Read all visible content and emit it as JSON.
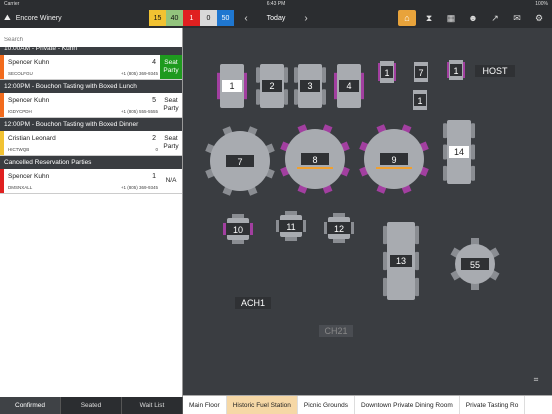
{
  "status": {
    "carrier": "Carrier",
    "time": "6:43 PM",
    "battery": "100%"
  },
  "app": {
    "name": "Encore Winery",
    "logo_icon": "vineyard-logo-icon"
  },
  "counts": [
    {
      "value": "15",
      "color": "#f1c232"
    },
    {
      "value": "40",
      "color": "#93c47d"
    },
    {
      "value": "1",
      "color": "#e02020"
    },
    {
      "value": "0",
      "color": "#d9d9d9"
    },
    {
      "value": "50",
      "color": "#1f77d0"
    }
  ],
  "date_nav": {
    "label": "Today",
    "prev_icon": "chevron-left-icon",
    "next_icon": "chevron-right-icon"
  },
  "tools": [
    {
      "icon": "home-icon",
      "glyph": "⌂",
      "active": true
    },
    {
      "icon": "hourglass-icon",
      "glyph": "⧗",
      "active": false
    },
    {
      "icon": "calendar-icon",
      "glyph": "▦",
      "active": false
    },
    {
      "icon": "guests-icon",
      "glyph": "☻",
      "active": false
    },
    {
      "icon": "chart-icon",
      "glyph": "↗",
      "active": false
    },
    {
      "icon": "mail-icon",
      "glyph": "✉",
      "active": false
    },
    {
      "icon": "settings-icon",
      "glyph": "⚙",
      "active": false
    }
  ],
  "search": {
    "placeholder": "Search"
  },
  "groups": [
    {
      "header": "10:00AM - Private - Kuhn",
      "rows": [
        {
          "name": "Spencer Kuhn",
          "code": "SECOLFGU",
          "phone": "+1 (805) 369-9345",
          "size": "4",
          "action": "Seat Party",
          "stripe": "#f26b1d",
          "action_green": true
        }
      ]
    },
    {
      "header": "12:00PM - Bouchon Tasting with Boxed Lunch",
      "rows": [
        {
          "name": "Spencer Kuhn",
          "code": "IGDYCPDH",
          "phone": "+1 (805) 555-5555",
          "size": "5",
          "action": "Seat Party",
          "stripe": "#f26b1d",
          "action_green": false
        }
      ]
    },
    {
      "header": "12:00PM - Bouchon Tasting with Boxed Dinner",
      "rows": [
        {
          "name": "Cristian Leonard",
          "code": "HICTWQB",
          "phone": "0",
          "size": "2",
          "action": "Seat Party",
          "stripe": "#f1c232",
          "action_green": false
        }
      ]
    },
    {
      "header": "Cancelled Reservation Parties",
      "rows": [
        {
          "name": "Spencer Kuhn",
          "code": "DMSNXALL",
          "phone": "+1 (805) 369-9345",
          "size": "1",
          "action": "N/A",
          "stripe": "#e02020",
          "action_green": false
        }
      ]
    }
  ],
  "bottom_tabs": [
    {
      "label": "Confirmed",
      "active": true
    },
    {
      "label": "Seated",
      "active": false
    },
    {
      "label": "Wait List",
      "active": false
    }
  ],
  "room_tabs": [
    {
      "label": "Main Floor",
      "active": false
    },
    {
      "label": "Historic Fuel Station",
      "active": true
    },
    {
      "label": "Picnic Grounds",
      "active": false
    },
    {
      "label": "Downtown Private Dining Room",
      "active": false
    },
    {
      "label": "Private Tasting Ro",
      "active": false
    }
  ],
  "floor": {
    "tables": [
      "1",
      "2",
      "3",
      "4",
      "1",
      "7",
      "1",
      "1",
      "7",
      "8",
      "9",
      "14",
      "10",
      "11",
      "12",
      "13",
      "55"
    ],
    "labels": [
      "HOST",
      "ACH1",
      "CH21"
    ],
    "highlighted": [
      "1",
      "14"
    ],
    "scan_icon": "qr-scan-icon"
  }
}
